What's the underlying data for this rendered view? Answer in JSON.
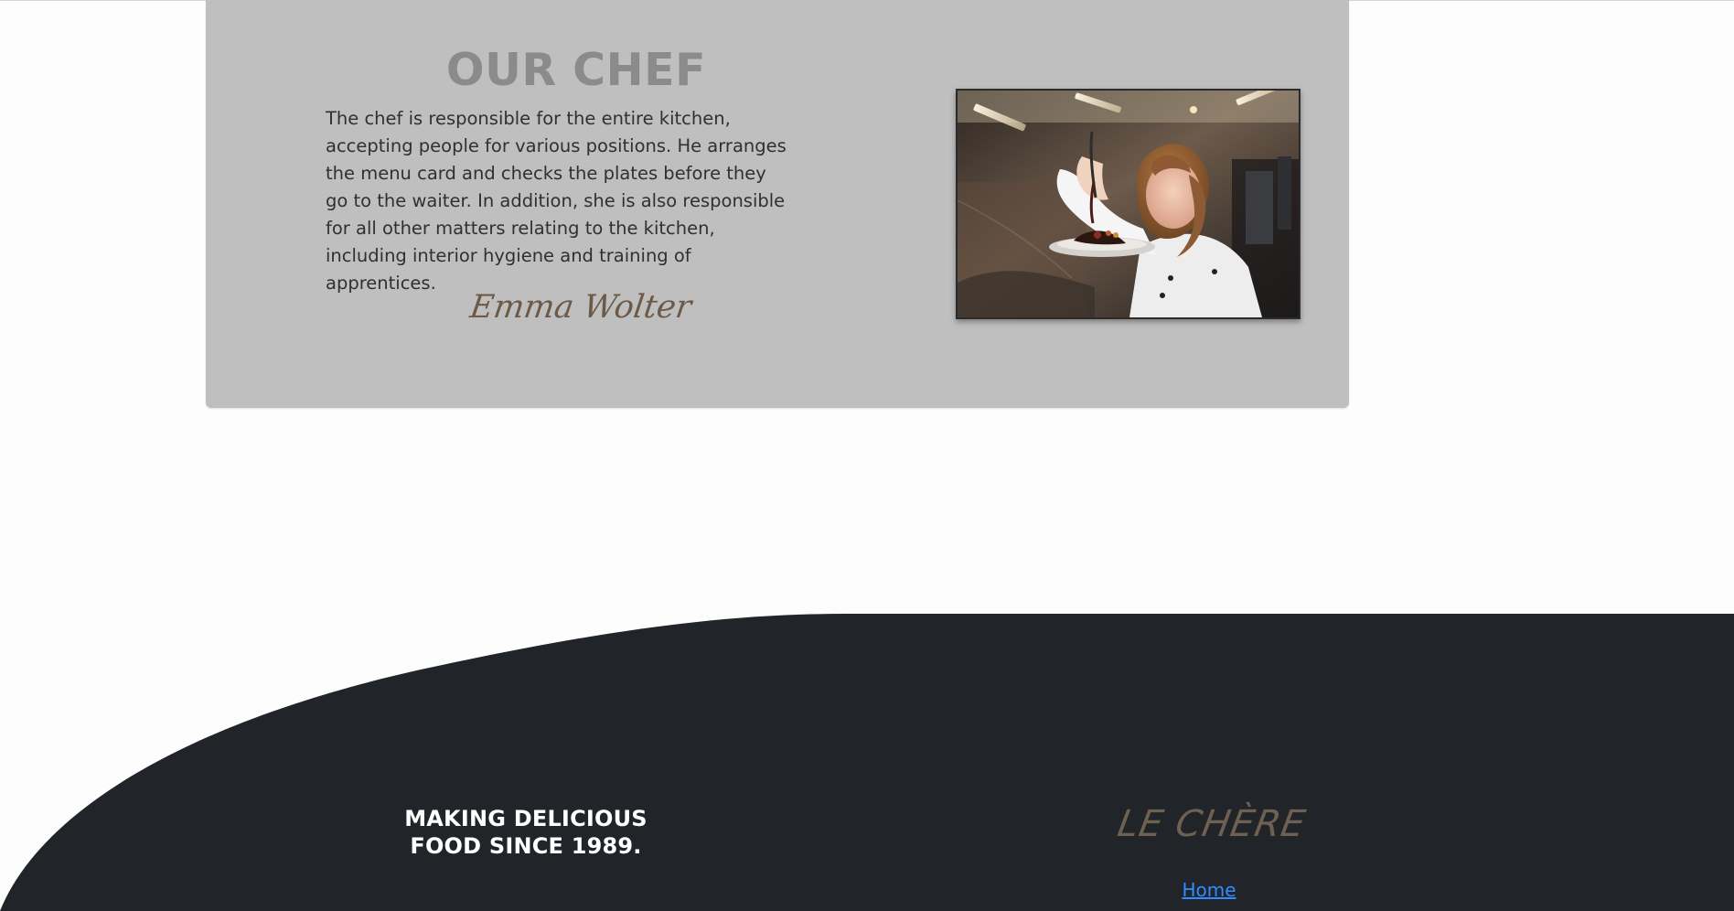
{
  "chef_section": {
    "title": "OUR CHEF",
    "description": "The chef is responsible for the entire kitchen, accepting people for various positions. He arranges the menu card and checks the plates before they go to the waiter. In addition, she is also responsible for all other matters relating to the kitchen, including interior hygiene and training of apprentices.",
    "signature": "Emma Wolter",
    "photo_label": "chef-photo"
  },
  "footer": {
    "tagline": "MAKING DELICIOUS FOOD SINCE 1989.",
    "brand": "LE CHÈRE",
    "links": [
      {
        "label": "Home"
      }
    ]
  },
  "colors": {
    "page_background": "#fdfdfd",
    "card_background": "#bfbfbf",
    "title_color": "#8b8b8b",
    "body_text": "#303030",
    "signature_color": "#6d5948",
    "footer_background": "#212429",
    "footer_text": "#ffffff",
    "brand_color": "#6f6152",
    "link_color": "#2f8cff"
  }
}
